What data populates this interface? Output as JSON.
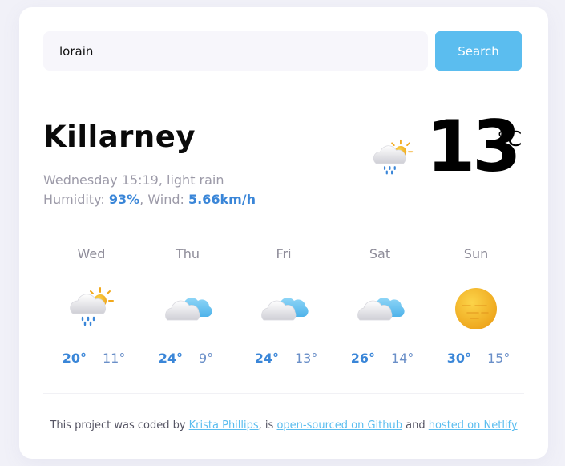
{
  "search": {
    "value": "lorain",
    "button_label": "Search"
  },
  "current": {
    "city": "Killarney",
    "description": "Wednesday 15:19, light rain",
    "humidity_label": "Humidity: ",
    "humidity_value": "93%",
    "wind_label": ", Wind: ",
    "wind_value": "5.66km/h",
    "temperature": "13",
    "unit": "°C",
    "icon": "light-rain-sun-icon"
  },
  "forecast": [
    {
      "day": "Wed",
      "max": "20°",
      "min": "11°",
      "icon": "light-rain-sun-icon"
    },
    {
      "day": "Thu",
      "max": "24°",
      "min": "9°",
      "icon": "cloudy-icon"
    },
    {
      "day": "Fri",
      "max": "24°",
      "min": "13°",
      "icon": "cloudy-icon"
    },
    {
      "day": "Sat",
      "max": "26°",
      "min": "14°",
      "icon": "cloudy-icon"
    },
    {
      "day": "Sun",
      "max": "30°",
      "min": "15°",
      "icon": "sun-icon"
    }
  ],
  "footer": {
    "prefix": "This project was coded by ",
    "author_link": "Krista Phillips",
    "middle": ", is ",
    "github_link": "open-sourced on Github",
    "and": " and ",
    "netlify_link": "hosted on Netlify"
  },
  "colors": {
    "accent": "#5bbdef",
    "highlight": "#3a86d8",
    "muted": "#9c9aa8"
  }
}
